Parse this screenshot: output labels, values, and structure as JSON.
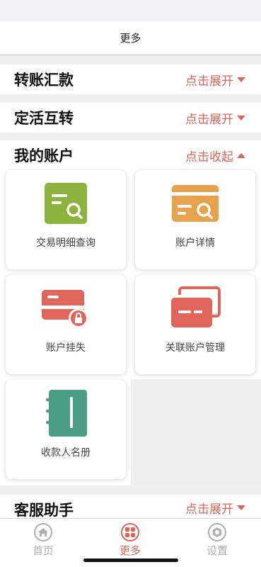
{
  "navbar": {
    "title": "更多"
  },
  "sections": [
    {
      "label": "转账汇款",
      "toggle": "点击展开",
      "state": "collapsed"
    },
    {
      "label": "定活互转",
      "toggle": "点击展开",
      "state": "collapsed"
    },
    {
      "label": "我的账户",
      "toggle": "点击收起",
      "state": "expanded"
    },
    {
      "label": "客服助手",
      "toggle": "点击展开",
      "state": "collapsed"
    }
  ],
  "account_items": [
    {
      "label": "交易明细查询",
      "icon": "transaction-search-icon",
      "color": "#8db33f"
    },
    {
      "label": "账户详情",
      "icon": "account-detail-icon",
      "color": "#e7a24d"
    },
    {
      "label": "账户挂失",
      "icon": "card-lock-icon",
      "color": "#e0655a"
    },
    {
      "label": "关联账户管理",
      "icon": "linked-cards-icon",
      "color": "#e0655a"
    },
    {
      "label": "收款人名册",
      "icon": "notebook-icon",
      "color": "#4a9e85"
    }
  ],
  "tabs": [
    {
      "label": "首页",
      "icon": "home-icon",
      "active": false
    },
    {
      "label": "更多",
      "icon": "grid-icon",
      "active": true
    },
    {
      "label": "设置",
      "icon": "settings-icon",
      "active": false
    }
  ],
  "colors": {
    "accent": "#d9665a",
    "inactive": "#b0b0b0"
  }
}
